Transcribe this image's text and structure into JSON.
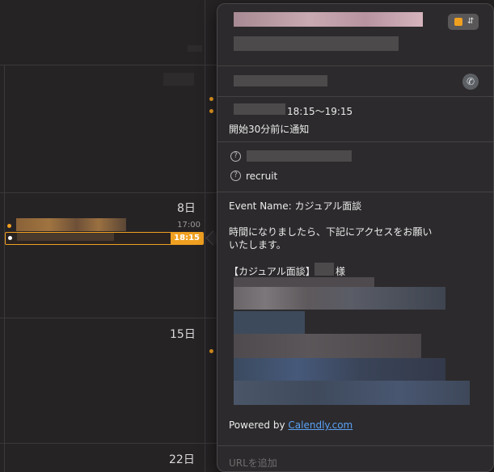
{
  "calendar": {
    "days": [
      {
        "label": "8日"
      },
      {
        "label": "15日"
      },
      {
        "label": "22日"
      }
    ],
    "events": [
      {
        "time": "17:00"
      },
      {
        "time": "18:15"
      }
    ]
  },
  "popover": {
    "time_range": "18:15〜19:15",
    "notify": "開始30分前に通知",
    "calendar_name": "recruit",
    "description": {
      "event_name": "Event Name: カジュアル面談",
      "line1": "時間になりましたら、下記にアクセスをお願い",
      "line2": "いたします。",
      "name_line_prefix": "【カジュアル面談】",
      "name_line_suffix": "様",
      "powered_by": "Powered by",
      "powered_link": "Calendly.com"
    },
    "add_url_placeholder": "URLを追加"
  },
  "colors": {
    "accent": "#f0a020",
    "link": "#5aa2f5"
  },
  "icons": {
    "color_picker": "color-swatch-icon",
    "call": "phone-icon",
    "calendar_help": "question-circle-icon"
  }
}
